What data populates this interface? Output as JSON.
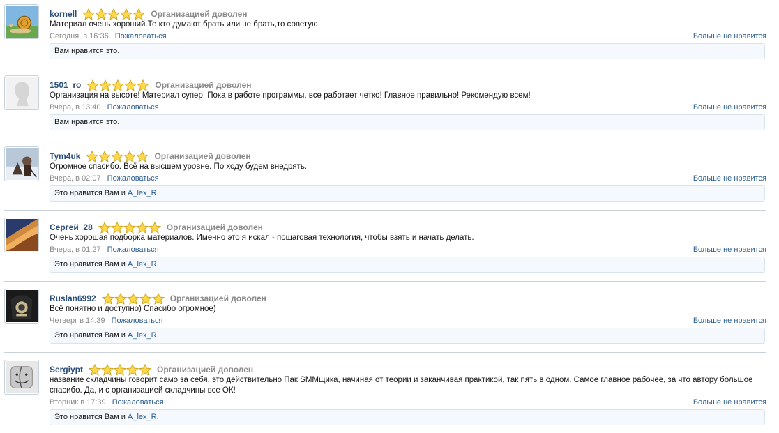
{
  "comments": [
    {
      "username": "kornell",
      "rating_text": "Организацией доволен",
      "stars": 5,
      "message": "Материал очень хороший.Те кто думают брать или не брать,то советую.",
      "time": "Сегодня, в 16:36",
      "report": "Пожаловаться",
      "unlike": "Больше не нравится",
      "likes_text": "Вам нравится это.",
      "likes_link": "",
      "avatar_icon": "snail-avatar-icon"
    },
    {
      "username": "1501_ro",
      "rating_text": "Организацией доволен",
      "stars": 5,
      "message": "Организация на высоте! Материал супер! Пока в работе программы, все работает четко! Главное правильно! Рекомендую всем!",
      "time": "Вчера, в 13:40",
      "report": "Пожаловаться",
      "unlike": "Больше не нравится",
      "likes_text": "Вам нравится это.",
      "likes_link": "",
      "avatar_icon": "default-avatar-icon"
    },
    {
      "username": "Tym4uk",
      "rating_text": "Организацией доволен",
      "stars": 5,
      "message": "Огромное спасибо. Всё на высшем уровне. По ходу будем внедрять.",
      "time": "Вчера, в 02:07",
      "report": "Пожаловаться",
      "unlike": "Больше не нравится",
      "likes_text": "Это нравится Вам и ",
      "likes_link": "A_lex_R.",
      "avatar_icon": "photo-avatar-icon"
    },
    {
      "username": "Сергей_28",
      "rating_text": "Организацией доволен",
      "stars": 5,
      "message": "Очень хорошая подборка материалов. Именно это я искал - пошаговая технология, чтобы взять и начать делать.",
      "time": "Вчера, в 01:27",
      "report": "Пожаловаться",
      "unlike": "Больше не нравится",
      "likes_text": "Это нравится Вам и ",
      "likes_link": "A_lex_R.",
      "avatar_icon": "landscape-avatar-icon"
    },
    {
      "username": "Ruslan6992",
      "rating_text": "Организацией доволен",
      "stars": 5,
      "message": "Всё понятно и доступно) Спасибо огромное)",
      "time": "Четверг в 14:39",
      "report": "Пожаловаться",
      "unlike": "Больше не нравится",
      "likes_text": "Это нравится Вам и ",
      "likes_link": "A_lex_R.",
      "avatar_icon": "shirt-avatar-icon"
    },
    {
      "username": "Sergiypt",
      "rating_text": "Организацией доволен",
      "stars": 5,
      "message": "название складчины говорит само за себя, это действительно Пак SMMщика, начиная от теории и заканчивая практикой, так пять в одном. Самое главное рабочее, за что автору большое спасибо. Да, и с организацией складчины все ОК!",
      "time": "Вторник в 17:39",
      "report": "Пожаловаться",
      "unlike": "Больше не нравится",
      "likes_text": "Это нравится Вам и ",
      "likes_link": "A_lex_R.",
      "avatar_icon": "finder-avatar-icon"
    }
  ]
}
